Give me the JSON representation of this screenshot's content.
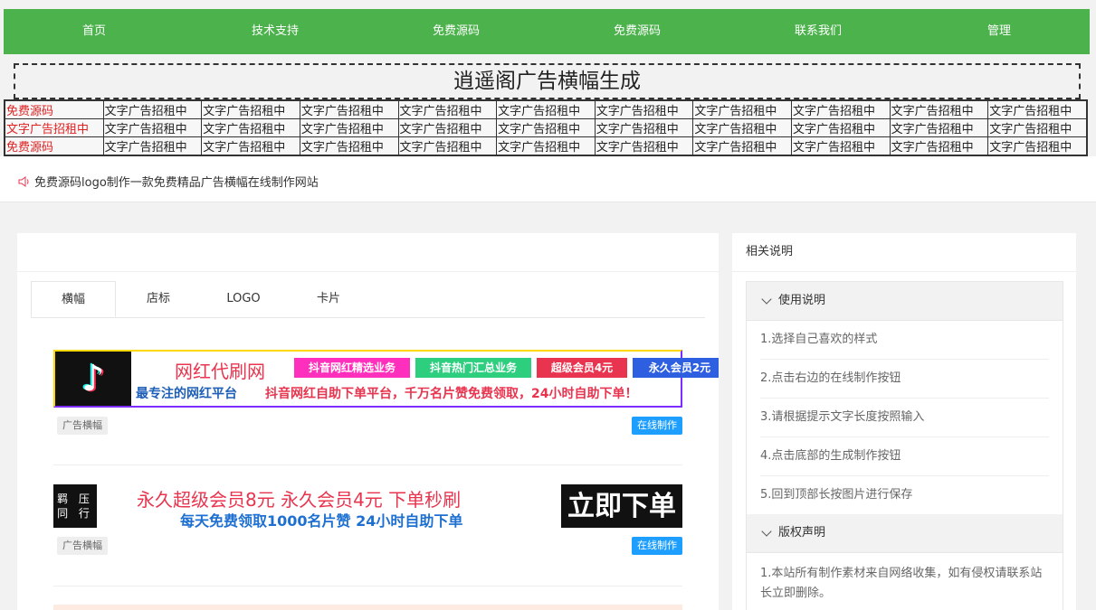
{
  "nav": {
    "items": [
      "首页",
      "技术支持",
      "免费源码",
      "免费源码",
      "联系我们",
      "管理"
    ]
  },
  "banner_title": "逍遥阁广告横幅生成",
  "ad_table": {
    "rows": [
      [
        "免费源码",
        "文字广告招租中",
        "文字广告招租中",
        "文字广告招租中",
        "文字广告招租中",
        "文字广告招租中",
        "文字广告招租中",
        "文字广告招租中",
        "文字广告招租中",
        "文字广告招租中",
        "文字广告招租中"
      ],
      [
        "文字广告招租中",
        "文字广告招租中",
        "文字广告招租中",
        "文字广告招租中",
        "文字广告招租中",
        "文字广告招租中",
        "文字广告招租中",
        "文字广告招租中",
        "文字广告招租中",
        "文字广告招租中",
        "文字广告招租中"
      ],
      [
        "免费源码",
        "文字广告招租中",
        "文字广告招租中",
        "文字广告招租中",
        "文字广告招租中",
        "文字广告招租中",
        "文字广告招租中",
        "文字广告招租中",
        "文字广告招租中",
        "文字广告招租中",
        "文字广告招租中"
      ]
    ]
  },
  "notice": {
    "text": "免费源码logo制作一款免费精品广告横幅在线制作网站"
  },
  "tabs": [
    "横幅",
    "店标",
    "LOGO",
    "卡片"
  ],
  "templates": [
    {
      "title": "网红代刷网",
      "subtitle": "最专注的网红平台",
      "pills": [
        "抖音网红精选业务",
        "抖音热门汇总业务",
        "超级会员4元",
        "永久会员2元"
      ],
      "desc": "抖音网红自助下单平台，千万名片赞免费领取，24小时自助下单！",
      "tag": "广告横幅",
      "button": "在线制作"
    },
    {
      "seal": [
        "羁 压",
        "同 行"
      ],
      "line1": "永久超级会员8元  永久会员4元  下单秒刷",
      "line2": "每天免费领取1000名片赞  24小时自助下单",
      "order_button": "立即下单",
      "tag": "广告横幅",
      "button": "在线制作"
    }
  ],
  "side": {
    "title": "相关说明",
    "usage_title": "使用说明",
    "steps": [
      "1.选择自己喜欢的样式",
      "2.点击右边的在线制作按钮",
      "3.请根据提示文字长度按照输入",
      "4.点击底部的生成制作按钮",
      "5.回到顶部长按图片进行保存"
    ],
    "copyright_title": "版权声明",
    "copyright_text": "1.本站所有制作素材来自网络收集，如有侵权请联系站长立即删除。"
  },
  "colors": {
    "nav_green": "#4cb24c",
    "button_blue": "#1e9fff",
    "red_text": "#e02020"
  }
}
